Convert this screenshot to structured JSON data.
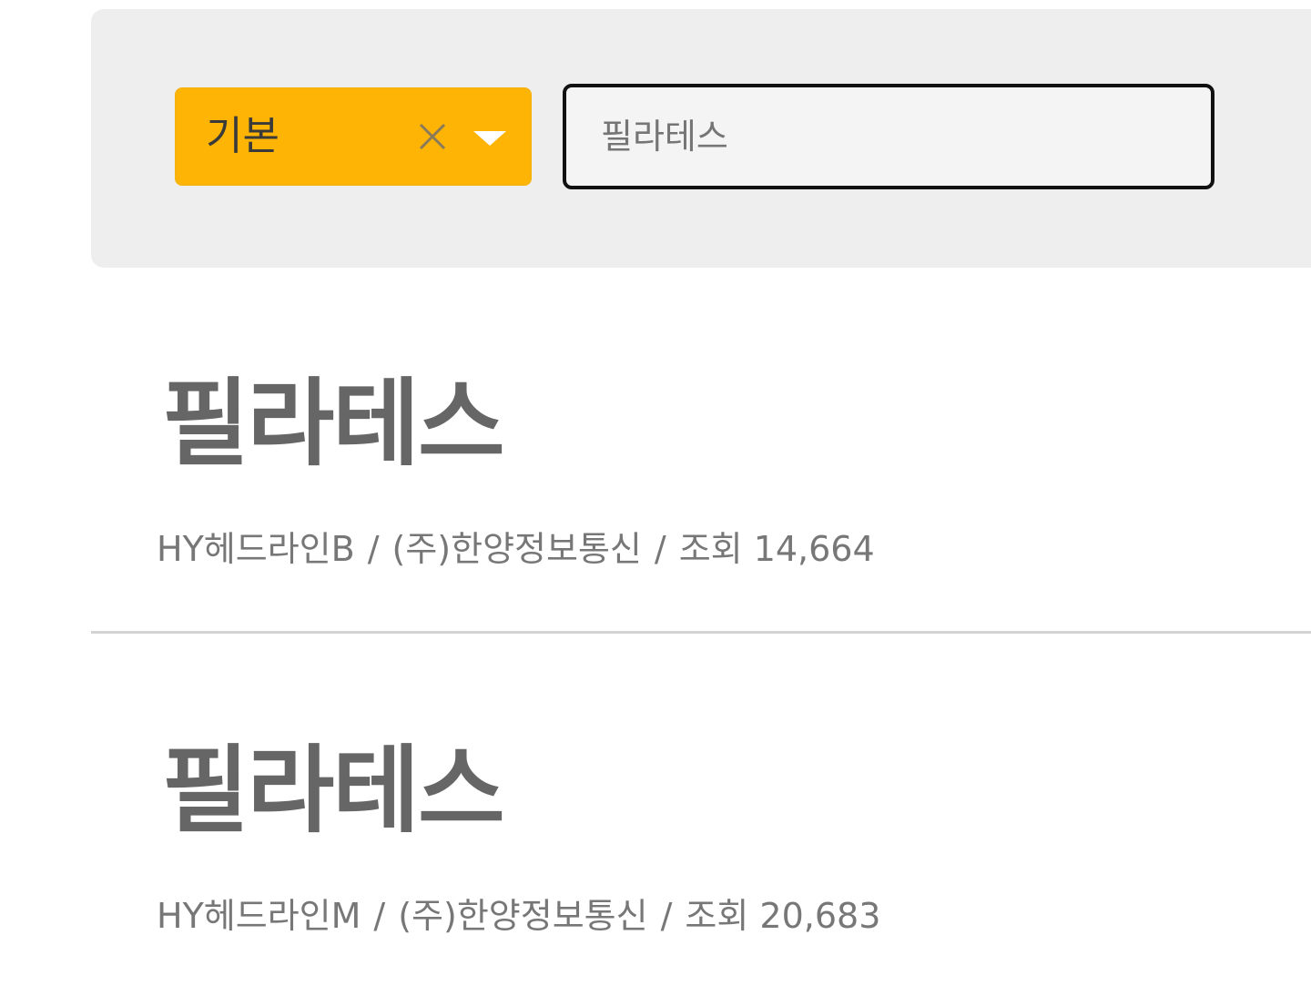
{
  "search": {
    "style_select": {
      "value": "기본",
      "clear_icon": "close-icon",
      "caret_icon": "caret-down-icon",
      "accent_color": "#fdb404"
    },
    "input": {
      "value": "",
      "placeholder": "필라테스"
    }
  },
  "results": [
    {
      "preview": "필라테스",
      "font_name": "HY헤드라인B",
      "foundry": "(주)한양정보통신",
      "separator": "/",
      "views_label": "조회 14,664"
    },
    {
      "preview": "필라테스",
      "font_name": "HY헤드라인M",
      "foundry": "(주)한양정보통신",
      "separator": "/",
      "views_label": "조회 20,683"
    }
  ]
}
